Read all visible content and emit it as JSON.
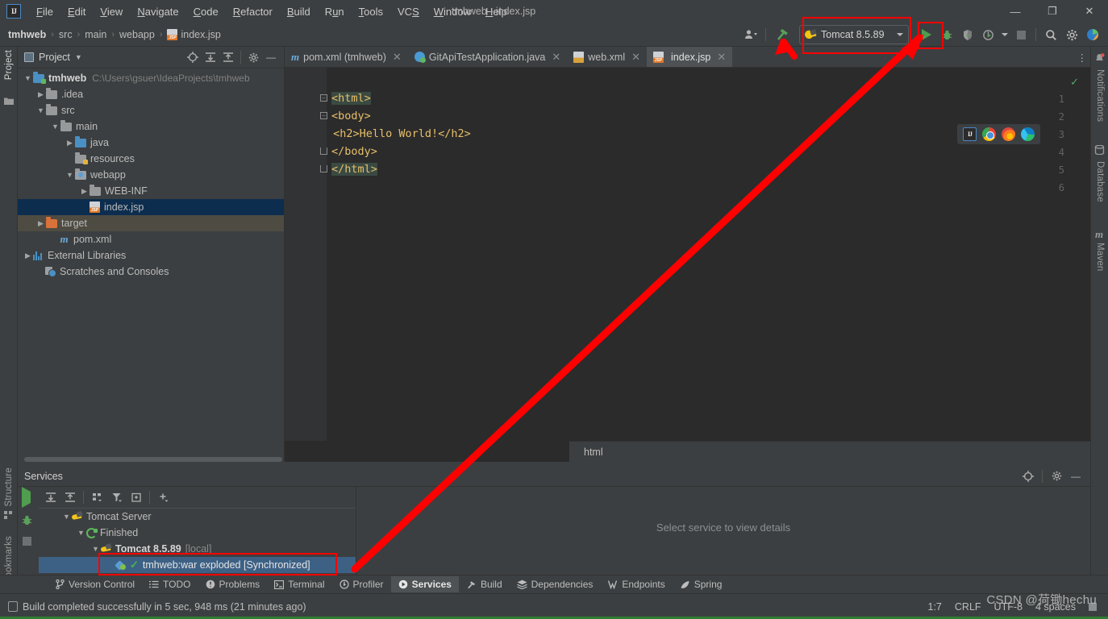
{
  "window": {
    "title": "tmhweb - index.jsp",
    "logo": "intellij-idea-logo",
    "controls": {
      "minimize": "—",
      "maximize": "❐",
      "close": "✕"
    }
  },
  "menubar": {
    "items": [
      "File",
      "Edit",
      "View",
      "Navigate",
      "Code",
      "Refactor",
      "Build",
      "Run",
      "Tools",
      "VCS",
      "Window",
      "Help"
    ]
  },
  "breadcrumb": {
    "items": [
      "tmhweb",
      "src",
      "main",
      "webapp",
      "index.jsp"
    ],
    "separator": "›"
  },
  "toolbar": {
    "run_config": "Tomcat 8.5.89",
    "run_button": "Run",
    "debug_button": "Debug",
    "coverage_button": "Run with Coverage",
    "profile_button": "Profile",
    "stop_button": "Stop",
    "search_button": "Search Everywhere",
    "settings_button": "Settings",
    "build_button": "Build Project",
    "account_button": "Account"
  },
  "left_tool_strip": {
    "top": [
      "Project"
    ],
    "bottom": [
      "Structure",
      "Bookmarks"
    ]
  },
  "right_tool_strip": {
    "items": [
      "Notifications",
      "Database",
      "Maven"
    ]
  },
  "project_panel": {
    "title": "Project",
    "tree": [
      {
        "label": "tmhweb",
        "path": "C:\\Users\\gsuer\\IdeaProjects\\tmhweb",
        "indent": 0,
        "arrow": "v",
        "icon": "folder-module",
        "bold": true
      },
      {
        "label": ".idea",
        "path": "",
        "indent": 1,
        "arrow": ">",
        "icon": "folder",
        "bold": false
      },
      {
        "label": "src",
        "path": "",
        "indent": 1,
        "arrow": "v",
        "icon": "folder",
        "bold": false
      },
      {
        "label": "main",
        "path": "",
        "indent": 2,
        "arrow": "v",
        "icon": "folder",
        "bold": false
      },
      {
        "label": "java",
        "path": "",
        "indent": 3,
        "arrow": ">",
        "icon": "folder-sources",
        "bold": false
      },
      {
        "label": "resources",
        "path": "",
        "indent": 3,
        "arrow": "",
        "icon": "folder-resources",
        "bold": false
      },
      {
        "label": "webapp",
        "path": "",
        "indent": 3,
        "arrow": "v",
        "icon": "folder-webapp",
        "bold": false
      },
      {
        "label": "WEB-INF",
        "path": "",
        "indent": 4,
        "arrow": ">",
        "icon": "folder",
        "bold": false
      },
      {
        "label": "index.jsp",
        "path": "",
        "indent": 4,
        "arrow": "",
        "icon": "jsp-file",
        "bold": false,
        "selected": true
      },
      {
        "label": "target",
        "path": "",
        "indent": 1,
        "arrow": ">",
        "icon": "folder-excluded",
        "bold": false,
        "highlighted": true
      },
      {
        "label": "pom.xml",
        "path": "",
        "indent": 1,
        "arrow": "",
        "icon": "maven-file",
        "bold": false
      },
      {
        "label": "External Libraries",
        "path": "",
        "indent": 0,
        "arrow": ">",
        "icon": "libraries",
        "bold": false
      },
      {
        "label": "Scratches and Consoles",
        "path": "",
        "indent": 0,
        "arrow": "",
        "icon": "scratches",
        "bold": false
      }
    ]
  },
  "editor": {
    "tabs": [
      {
        "label": "pom.xml (tmhweb)",
        "icon": "maven-file",
        "active": false
      },
      {
        "label": "GitApiTestApplication.java",
        "icon": "java-class",
        "active": false
      },
      {
        "label": "web.xml",
        "icon": "xml-file",
        "active": false
      },
      {
        "label": "index.jsp",
        "icon": "jsp-file",
        "active": true
      }
    ],
    "line_numbers": [
      "1",
      "2",
      "3",
      "4",
      "5",
      "6"
    ],
    "code_lines": [
      "<html>",
      "<body>",
      " <h2>Hello World!</h2>",
      "</body>",
      "</html>",
      ""
    ],
    "breadcrumb": "html",
    "inspection_status": "✓",
    "browsers": [
      "intellij-idea",
      "chrome",
      "firefox",
      "edge"
    ]
  },
  "services_panel": {
    "title": "Services",
    "detail_placeholder": "Select service to view details",
    "tree": [
      {
        "label": "Tomcat Server",
        "indent": 0,
        "arrow": "v",
        "icon": "tomcat",
        "bold": false
      },
      {
        "label": "Finished",
        "indent": 1,
        "arrow": "v",
        "icon": "finished",
        "bold": false
      },
      {
        "label": "Tomcat 8.5.89",
        "suffix": "[local]",
        "indent": 2,
        "arrow": "v",
        "icon": "tomcat",
        "bold": true
      },
      {
        "label": "tmhweb:war exploded [Synchronized]",
        "indent": 3,
        "arrow": "",
        "icon": "war-artifact",
        "bold": false,
        "selected": true
      }
    ]
  },
  "tool_windows": {
    "items": [
      {
        "label": "Version Control",
        "icon": "branch-icon",
        "active": false
      },
      {
        "label": "TODO",
        "icon": "list-icon",
        "active": false
      },
      {
        "label": "Problems",
        "icon": "warning-icon",
        "active": false
      },
      {
        "label": "Terminal",
        "icon": "terminal-icon",
        "active": false
      },
      {
        "label": "Profiler",
        "icon": "profiler-icon",
        "active": false
      },
      {
        "label": "Services",
        "icon": "services-icon",
        "active": true
      },
      {
        "label": "Build",
        "icon": "hammer-icon",
        "active": false
      },
      {
        "label": "Dependencies",
        "icon": "layers-icon",
        "active": false
      },
      {
        "label": "Endpoints",
        "icon": "endpoints-icon",
        "active": false
      },
      {
        "label": "Spring",
        "icon": "spring-leaf-icon",
        "active": false
      }
    ]
  },
  "status_bar": {
    "message": "Build completed successfully in 5 sec, 948 ms (21 minutes ago)",
    "caret_position": "1:7",
    "line_separator": "CRLF",
    "encoding": "UTF-8",
    "indent": "4 spaces"
  },
  "watermark": "CSDN @荷锄hechu",
  "colors": {
    "background": "#3c3f41",
    "editor_bg": "#2b2b2b",
    "selection_blue": "#0d2d4e",
    "services_selection": "#3d6185",
    "target_highlight": "#4e4b42",
    "annotation_red": "#ff0000",
    "run_green": "#4f9d4f",
    "tag_color": "#e8bf6a"
  }
}
